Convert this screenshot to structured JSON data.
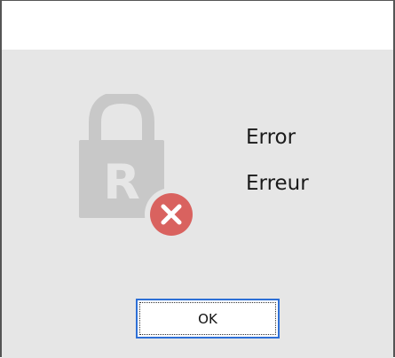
{
  "dialog": {
    "messages": [
      "Error",
      "Erreur"
    ],
    "ok_label": "OK",
    "icon": {
      "name": "lock-error-icon",
      "lock_letter": "R",
      "lock_color": "#c8c8c8",
      "error_badge_color": "#d9625f"
    },
    "accent_color": "#2d6fd6"
  }
}
